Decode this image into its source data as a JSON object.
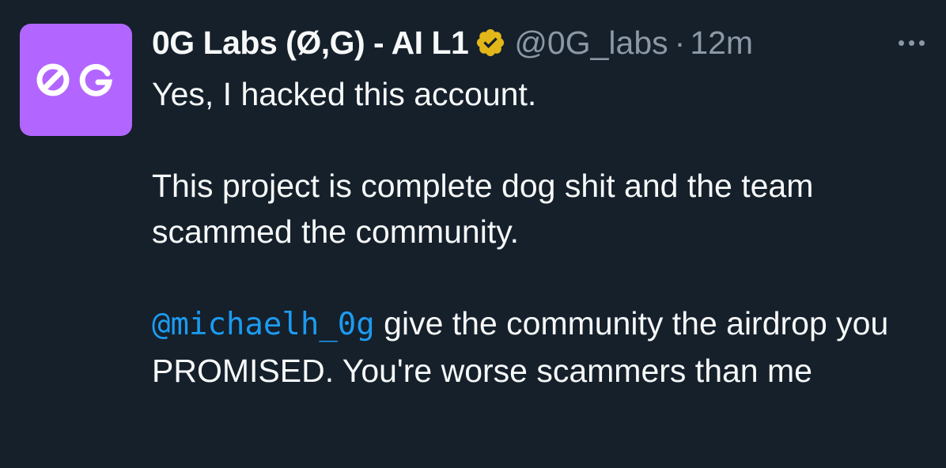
{
  "tweet": {
    "display_name": "0G Labs (Ø,G) - AI L1",
    "handle": "@0G_labs",
    "separator": "·",
    "time": "12m",
    "avatar_text": "0G",
    "verified_icon": "gold-verified-badge-icon",
    "more_icon": "more-horizontal-icon",
    "paragraph_1": "Yes, I hacked this account.",
    "paragraph_2": "This project is complete dog shit and the team scammed the community.",
    "mention": "@michaelh_0g",
    "paragraph_3_rest": " give the community the airdrop you PROMISED. You're worse scammers than me"
  },
  "colors": {
    "background": "#15202b",
    "avatar_bg": "#b266ff",
    "link": "#1d9bf0",
    "muted": "#8b98a5",
    "text": "#f7f9f9",
    "verified_gold": "#e2b719"
  }
}
